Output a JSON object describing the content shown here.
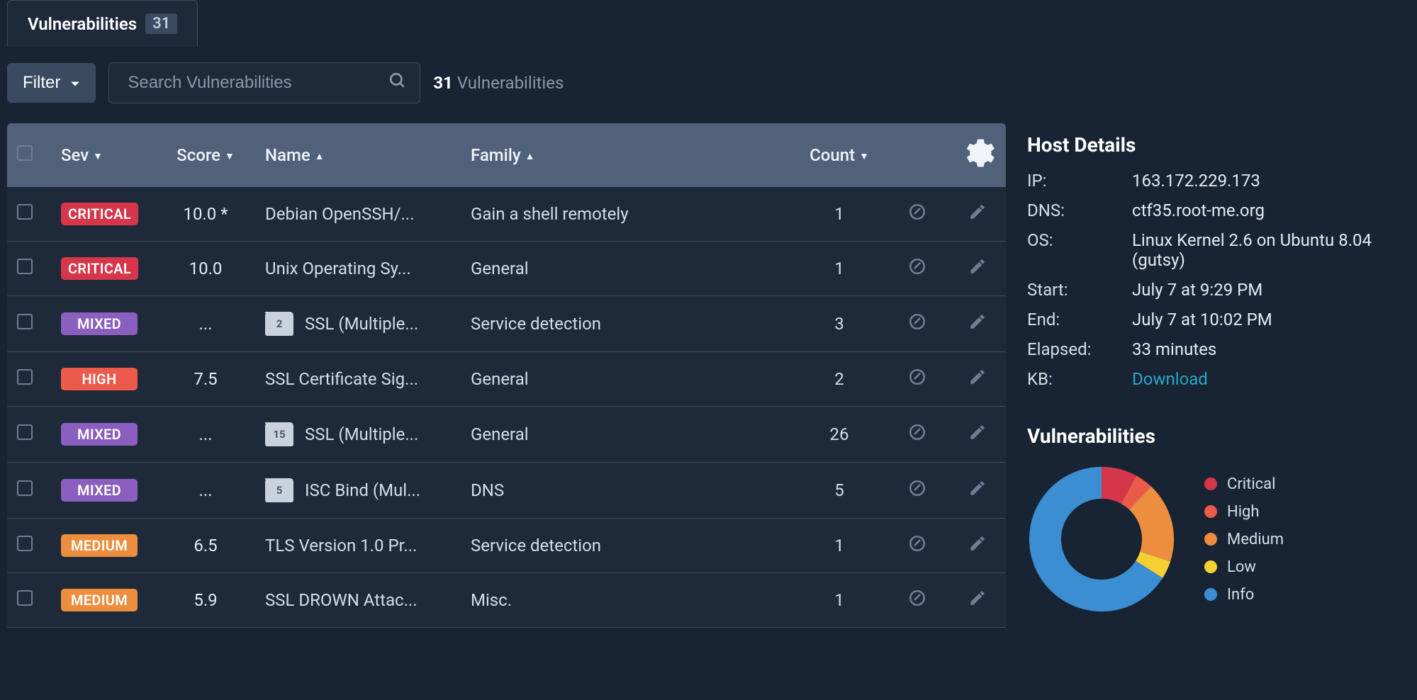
{
  "tabs": {
    "vulnerabilities": {
      "label": "Vulnerabilities",
      "count": "31"
    }
  },
  "toolbar": {
    "filter_label": "Filter",
    "search_placeholder": "Search Vulnerabilities",
    "result_count": "31",
    "result_noun": "Vulnerabilities"
  },
  "headers": {
    "sev": "Sev",
    "score": "Score",
    "name": "Name",
    "family": "Family",
    "count": "Count"
  },
  "rows": [
    {
      "sev": "CRITICAL",
      "score": "10.0 *",
      "name": "Debian OpenSSH/...",
      "family": "Gain a shell remotely",
      "count": "1",
      "folder": null
    },
    {
      "sev": "CRITICAL",
      "score": "10.0",
      "name": "Unix Operating Sy...",
      "family": "General",
      "count": "1",
      "folder": null
    },
    {
      "sev": "MIXED",
      "score": "...",
      "name": "SSL (Multiple...",
      "family": "Service detection",
      "count": "3",
      "folder": "2"
    },
    {
      "sev": "HIGH",
      "score": "7.5",
      "name": "SSL Certificate Sig...",
      "family": "General",
      "count": "2",
      "folder": null
    },
    {
      "sev": "MIXED",
      "score": "...",
      "name": "SSL (Multiple...",
      "family": "General",
      "count": "26",
      "folder": "15"
    },
    {
      "sev": "MIXED",
      "score": "...",
      "name": "ISC Bind (Mul...",
      "family": "DNS",
      "count": "5",
      "folder": "5"
    },
    {
      "sev": "MEDIUM",
      "score": "6.5",
      "name": "TLS Version 1.0 Pr...",
      "family": "Service detection",
      "count": "1",
      "folder": null
    },
    {
      "sev": "MEDIUM",
      "score": "5.9",
      "name": "SSL DROWN Attac...",
      "family": "Misc.",
      "count": "1",
      "folder": null
    }
  ],
  "host": {
    "title": "Host Details",
    "labels": {
      "ip": "IP:",
      "dns": "DNS:",
      "os": "OS:",
      "start": "Start:",
      "end": "End:",
      "elapsed": "Elapsed:",
      "kb": "KB:"
    },
    "ip": "163.172.229.173",
    "dns": "ctf35.root-me.org",
    "os": "Linux Kernel 2.6 on Ubuntu 8.04 (gutsy)",
    "start": "July 7 at 9:29 PM",
    "end": "July 7 at 10:02 PM",
    "elapsed": "33 minutes",
    "kb": "Download"
  },
  "side_chart": {
    "title": "Vulnerabilities",
    "legend": {
      "critical": "Critical",
      "high": "High",
      "medium": "Medium",
      "low": "Low",
      "info": "Info"
    }
  },
  "chart_data": {
    "type": "pie",
    "title": "Vulnerabilities",
    "series": [
      {
        "name": "Critical",
        "value": 8,
        "color": "#d63649"
      },
      {
        "name": "High",
        "value": 4,
        "color": "#ec5a4b"
      },
      {
        "name": "Medium",
        "value": 18,
        "color": "#ec8e3d"
      },
      {
        "name": "Low",
        "value": 4,
        "color": "#f5d033"
      },
      {
        "name": "Info",
        "value": 66,
        "color": "#3a8ed1"
      }
    ]
  }
}
